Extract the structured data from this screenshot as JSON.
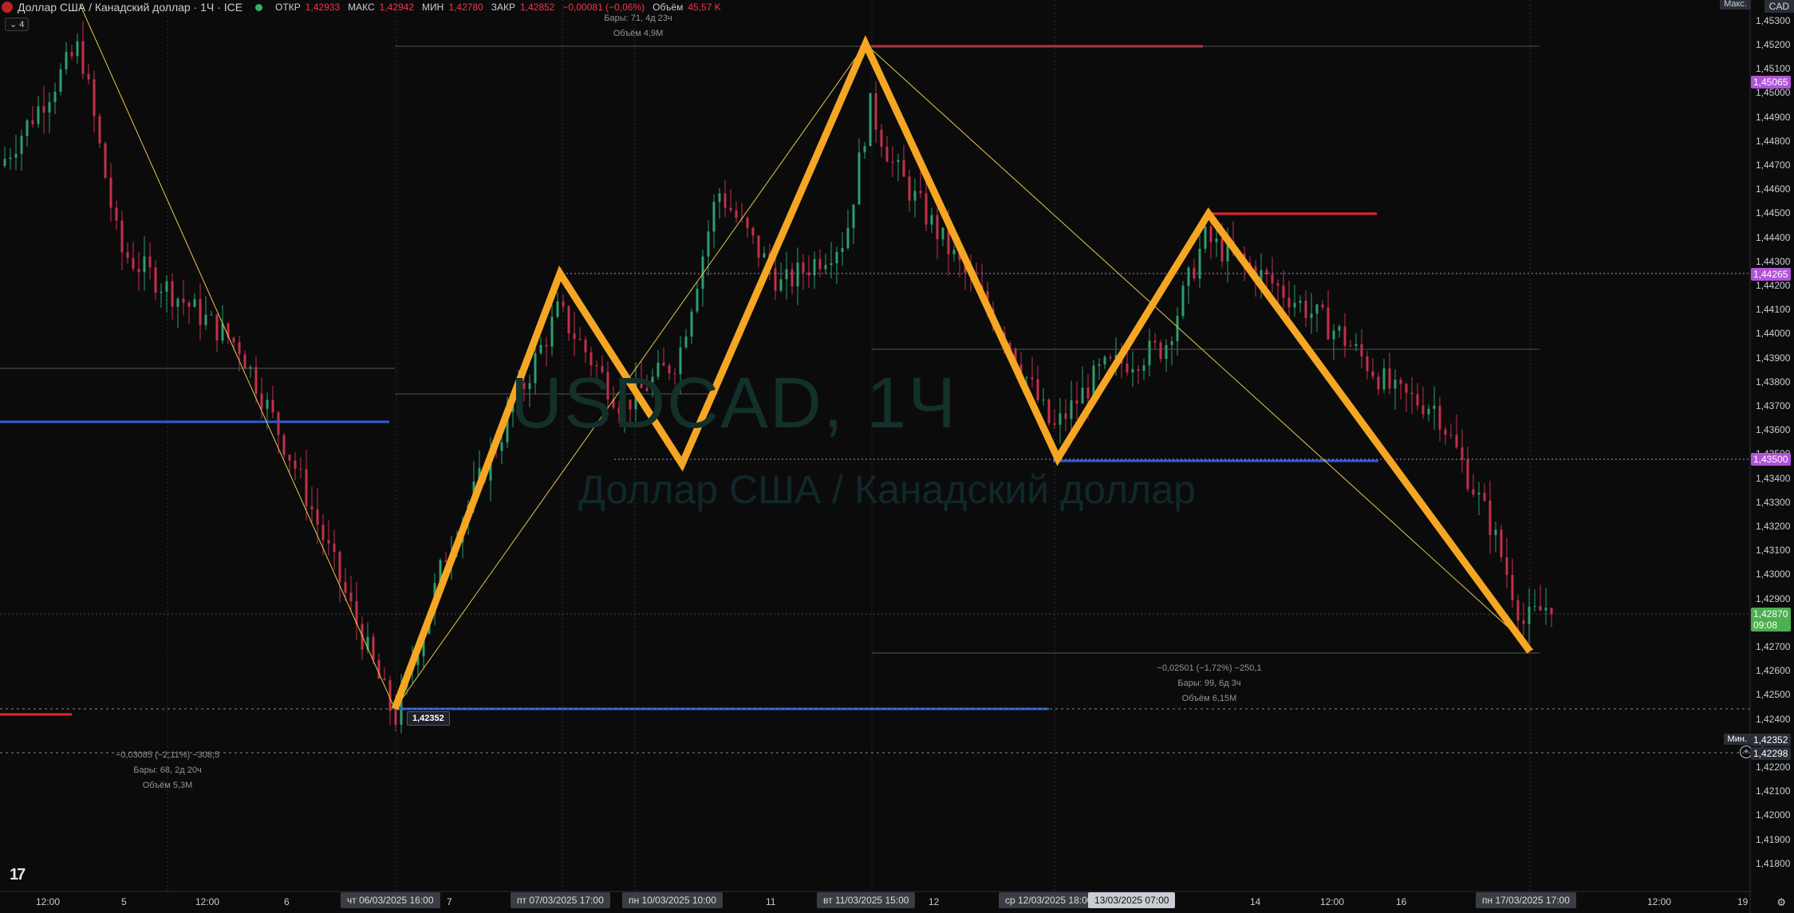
{
  "header": {
    "title": "Доллар США / Канадский доллар · 1Ч · ICE",
    "open_label": "ОТКР",
    "open": "1,42933",
    "high_label": "МАКС",
    "high": "1,42942",
    "low_label": "МИН",
    "low": "1,42780",
    "close_label": "ЗАКР",
    "close": "1,42852",
    "change": "−0,00081 (−0,06%)",
    "volume_label": "Объём",
    "volume": "45,57 K"
  },
  "indicator_badge": "4",
  "watermark": {
    "symbol": "USDCAD, 1Ч",
    "name": "Доллар США / Канадский доллар"
  },
  "currency": "CAD",
  "max_label": "Макс.",
  "min_label": "Мин.",
  "y_axis": {
    "ticks": [
      "1,45300",
      "1,45200",
      "1,45100",
      "1,45000",
      "1,44900",
      "1,44800",
      "1,44700",
      "1,44600",
      "1,44500",
      "1,44400",
      "1,44300",
      "1,44200",
      "1,44100",
      "1,44000",
      "1,43900",
      "1,43800",
      "1,43700",
      "1,43600",
      "1,43500",
      "1,43400",
      "1,43300",
      "1,43200",
      "1,43100",
      "1,43000",
      "1,42900",
      "1,42800",
      "1,42700",
      "1,42600",
      "1,42500",
      "1,42400",
      "1,42300",
      "1,42200",
      "1,42100",
      "1,42000",
      "1,41900",
      "1,41800"
    ],
    "tags": [
      {
        "name": "high-price-tag",
        "text": "1,45065",
        "color": "#b153d9"
      },
      {
        "name": "level-tag-upper",
        "text": "1,44265",
        "color": "#b153d9"
      },
      {
        "name": "level-tag-lower",
        "text": "1,43500",
        "color": "#b153d9"
      },
      {
        "name": "last-price-tag",
        "text": "1,42870",
        "sub": "09:08",
        "color": "#4caf50"
      },
      {
        "name": "min-price-tag",
        "text": "1,42352",
        "color": "#2a2e36"
      },
      {
        "name": "cursor-price-tag",
        "text": "1,42298",
        "color": "#2a2e36"
      }
    ]
  },
  "x_axis": {
    "labels": [
      "12:00",
      "5",
      "12:00",
      "6",
      "7",
      "11",
      "12",
      "14",
      "12:00",
      "16",
      "12:00",
      "19"
    ],
    "tags": [
      "чт 06/03/2025   16:00",
      "пт 07/03/2025   17:00",
      "пн 10/03/2025   10:00",
      "вт 11/03/2025   15:00",
      "ср 12/03/2025   18:00",
      "13/03/2025   07:00",
      "пн 17/03/2025   17:00"
    ]
  },
  "measurements": [
    {
      "name": "measure-top",
      "lines": [
        "Бары: 71, 4д 23ч",
        "Объём 4,9M"
      ]
    },
    {
      "name": "measure-right",
      "lines": [
        "−0,02501 (−1,72%) −250,1",
        "Бары: 99, 6д 3ч",
        "Объём 6,15M"
      ]
    },
    {
      "name": "measure-left",
      "lines": [
        "−0,03085 (−2,11%) −308,5",
        "Бары: 68, 2д 20ч",
        "Объём 5,3M"
      ]
    }
  ],
  "price_note": "1,42352",
  "colors": {
    "pattern": "#f5a623",
    "red_level": "#e8232b",
    "blue_level": "#2f5bd7",
    "bull": "#2e9e6e",
    "bear": "#c3304a",
    "dotted": "#c27ae0"
  }
}
